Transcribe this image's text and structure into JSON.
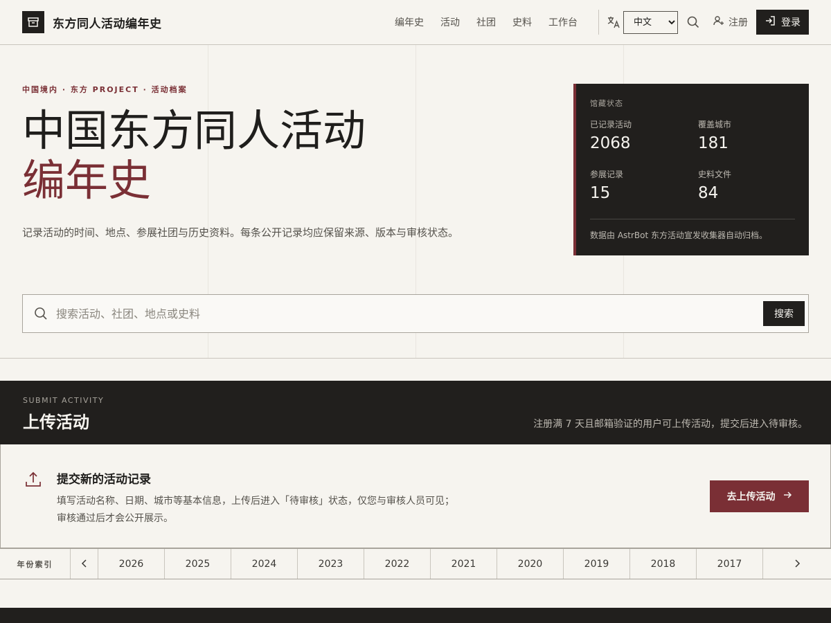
{
  "header": {
    "site_title": "东方同人活动编年史",
    "logo_icon": "archive-box-icon",
    "nav": [
      {
        "label": "编年史"
      },
      {
        "label": "活动"
      },
      {
        "label": "社团"
      },
      {
        "label": "史料"
      },
      {
        "label": "工作台"
      }
    ],
    "language": {
      "selected": "中文",
      "options": [
        "中文"
      ]
    },
    "register_label": "注册",
    "login_label": "登录"
  },
  "hero": {
    "kicker": "中国境内 · 东方 PROJECT · 活动档案",
    "title_line1": "中国东方同人活动",
    "title_line2": "编年史",
    "description": "记录活动的时间、地点、参展社团与历史资料。每条公开记录均应保留来源、版本与审核状态。",
    "stats": {
      "heading": "馆藏状态",
      "items": [
        {
          "label": "已记录活动",
          "value": "2068"
        },
        {
          "label": "覆盖城市",
          "value": "181"
        },
        {
          "label": "参展记录",
          "value": "15"
        },
        {
          "label": "史料文件",
          "value": "84"
        }
      ],
      "note": "数据由 AstrBot 东方活动宣发收集器自动归档。"
    },
    "search": {
      "placeholder": "搜索活动、社团、地点或史料",
      "value": "",
      "button_label": "搜索"
    }
  },
  "submit": {
    "kicker": "SUBMIT ACTIVITY",
    "title": "上传活动",
    "note": "注册满 7 天且邮箱验证的用户可上传活动，提交后进入待审核。",
    "card_title": "提交新的活动记录",
    "card_desc_line1": "填写活动名称、日期、城市等基本信息，上传后进入「待审核」状态，仅您与审核人员可见；",
    "card_desc_line2": "审核通过后才会公开展示。",
    "cta_label": "去上传活动"
  },
  "year_index": {
    "label": "年份索引",
    "years": [
      "2026",
      "2025",
      "2024",
      "2023",
      "2022",
      "2021",
      "2020",
      "2019",
      "2018",
      "2017"
    ]
  },
  "colors": {
    "accent": "#7a2f35",
    "dark": "#211f1d",
    "background": "#f6f4ef"
  }
}
